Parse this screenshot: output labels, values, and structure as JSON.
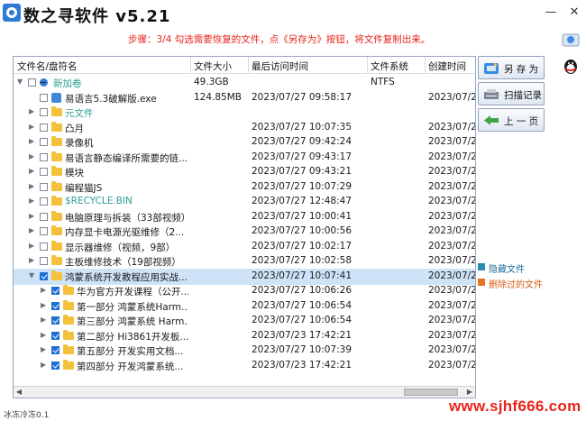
{
  "window": {
    "title": "数之寻软件 v5.21",
    "minimize": "—",
    "close": "✕"
  },
  "step_text": "步骤：3/4 勾选需要恢复的文件，点《另存为》按钮，将文件复制出来。",
  "columns": [
    "文件名/盘符名",
    "文件大小",
    "最后访问时间",
    "文件系统",
    "创建时间"
  ],
  "rows": [
    {
      "name": "新加卷",
      "size": "49.3GB",
      "time": "",
      "fs": "NTFS",
      "ctime": "",
      "level": 0,
      "kind": "drive",
      "checked": false,
      "expanded": true,
      "name_color": "#2a9d8f"
    },
    {
      "name": "易语言5.3破解版.exe",
      "size": "124.85MB",
      "time": "2023/07/27 09:58:17",
      "fs": "",
      "ctime": "2023/07/2",
      "level": 1,
      "kind": "exe",
      "checked": false,
      "name_color": "#1a1a1a"
    },
    {
      "name": "元文件",
      "size": "",
      "time": "",
      "fs": "",
      "ctime": "",
      "level": 1,
      "kind": "folder",
      "checked": false,
      "name_color": "#2a9d8f"
    },
    {
      "name": "凸月",
      "size": "",
      "time": "2023/07/27 10:07:35",
      "fs": "",
      "ctime": "2023/07/2",
      "level": 1,
      "kind": "folder",
      "checked": false,
      "name_color": "#1a1a1a"
    },
    {
      "name": "录像机",
      "size": "",
      "time": "2023/07/27 09:42:24",
      "fs": "",
      "ctime": "2023/07/2",
      "level": 1,
      "kind": "folder",
      "checked": false,
      "name_color": "#1a1a1a"
    },
    {
      "name": "易语言静态编译所需要的链...",
      "size": "",
      "time": "2023/07/27 09:43:17",
      "fs": "",
      "ctime": "2023/07/2",
      "level": 1,
      "kind": "folder",
      "checked": false,
      "name_color": "#1a1a1a"
    },
    {
      "name": "模块",
      "size": "",
      "time": "2023/07/27 09:43:21",
      "fs": "",
      "ctime": "2023/07/2",
      "level": 1,
      "kind": "folder",
      "checked": false,
      "name_color": "#1a1a1a"
    },
    {
      "name": "编程猫JS",
      "size": "",
      "time": "2023/07/27 10:07:29",
      "fs": "",
      "ctime": "2023/07/2",
      "level": 1,
      "kind": "folder",
      "checked": false,
      "name_color": "#1a1a1a"
    },
    {
      "name": "$RECYCLE.BIN",
      "size": "",
      "time": "2023/07/27 12:48:47",
      "fs": "",
      "ctime": "2023/07/2",
      "level": 1,
      "kind": "folder",
      "checked": false,
      "name_color": "#2a9d8f"
    },
    {
      "name": "电脑原理与拆装（33部视频）",
      "size": "",
      "time": "2023/07/27 10:00:41",
      "fs": "",
      "ctime": "2023/07/2",
      "level": 1,
      "kind": "folder",
      "checked": false,
      "name_color": "#1a1a1a"
    },
    {
      "name": "内存显卡电源光驱维修（2...",
      "size": "",
      "time": "2023/07/27 10:00:56",
      "fs": "",
      "ctime": "2023/07/2",
      "level": 1,
      "kind": "folder",
      "checked": false,
      "name_color": "#1a1a1a"
    },
    {
      "name": "显示器维修（视频，9部）",
      "size": "",
      "time": "2023/07/27 10:02:17",
      "fs": "",
      "ctime": "2023/07/2",
      "level": 1,
      "kind": "folder",
      "checked": false,
      "name_color": "#1a1a1a"
    },
    {
      "name": "主板维修技术（19部视频）",
      "size": "",
      "time": "2023/07/27 10:02:58",
      "fs": "",
      "ctime": "2023/07/2",
      "level": 1,
      "kind": "folder",
      "checked": false,
      "name_color": "#1a1a1a"
    },
    {
      "name": "鸿蒙系统开发教程应用实战...",
      "size": "",
      "time": "2023/07/27 10:07:41",
      "fs": "",
      "ctime": "2023/07/2",
      "level": 1,
      "kind": "folder",
      "checked": true,
      "expanded": true,
      "selected": true,
      "name_color": "#1a1a1a"
    },
    {
      "name": "华为官方开发课程（公开...",
      "size": "",
      "time": "2023/07/27 10:06:26",
      "fs": "",
      "ctime": "2023/07/2",
      "level": 2,
      "kind": "folder",
      "checked": true,
      "name_color": "#1a1a1a"
    },
    {
      "name": "第一部分 鸿蒙系统Harm...",
      "size": "",
      "time": "2023/07/27 10:06:54",
      "fs": "",
      "ctime": "2023/07/2",
      "level": 2,
      "kind": "folder",
      "checked": true,
      "name_color": "#1a1a1a"
    },
    {
      "name": "第三部分 鸿蒙系统 Harm...",
      "size": "",
      "time": "2023/07/27 10:06:54",
      "fs": "",
      "ctime": "2023/07/2",
      "level": 2,
      "kind": "folder",
      "checked": true,
      "name_color": "#1a1a1a"
    },
    {
      "name": "第二部分 Hi3861开发板...",
      "size": "",
      "time": "2023/07/23 17:42:21",
      "fs": "",
      "ctime": "2023/07/2",
      "level": 2,
      "kind": "folder",
      "checked": true,
      "name_color": "#1a1a1a"
    },
    {
      "name": "第五部分 开发实用文档...",
      "size": "",
      "time": "2023/07/27 10:07:39",
      "fs": "",
      "ctime": "2023/07/2",
      "level": 2,
      "kind": "folder",
      "checked": true,
      "name_color": "#1a1a1a"
    },
    {
      "name": "第四部分 开发鸿蒙系统...",
      "size": "",
      "time": "2023/07/23 17:42:21",
      "fs": "",
      "ctime": "2023/07/2",
      "level": 2,
      "kind": "folder",
      "checked": true,
      "name_color": "#1a1a1a"
    }
  ],
  "buttons": {
    "save_as": "另 存 为",
    "scan_records": "扫描记录",
    "prev": "上 一 页"
  },
  "legend": [
    {
      "label": "隐藏文件",
      "color": "#2b8bb6",
      "text_color": "#1f6e9a"
    },
    {
      "label": "删除过的文件",
      "color": "#e8731b",
      "text_color": "#d95a12"
    }
  ],
  "status": "冰冻冷冻0.1",
  "watermark": "www.sjhf666.com"
}
